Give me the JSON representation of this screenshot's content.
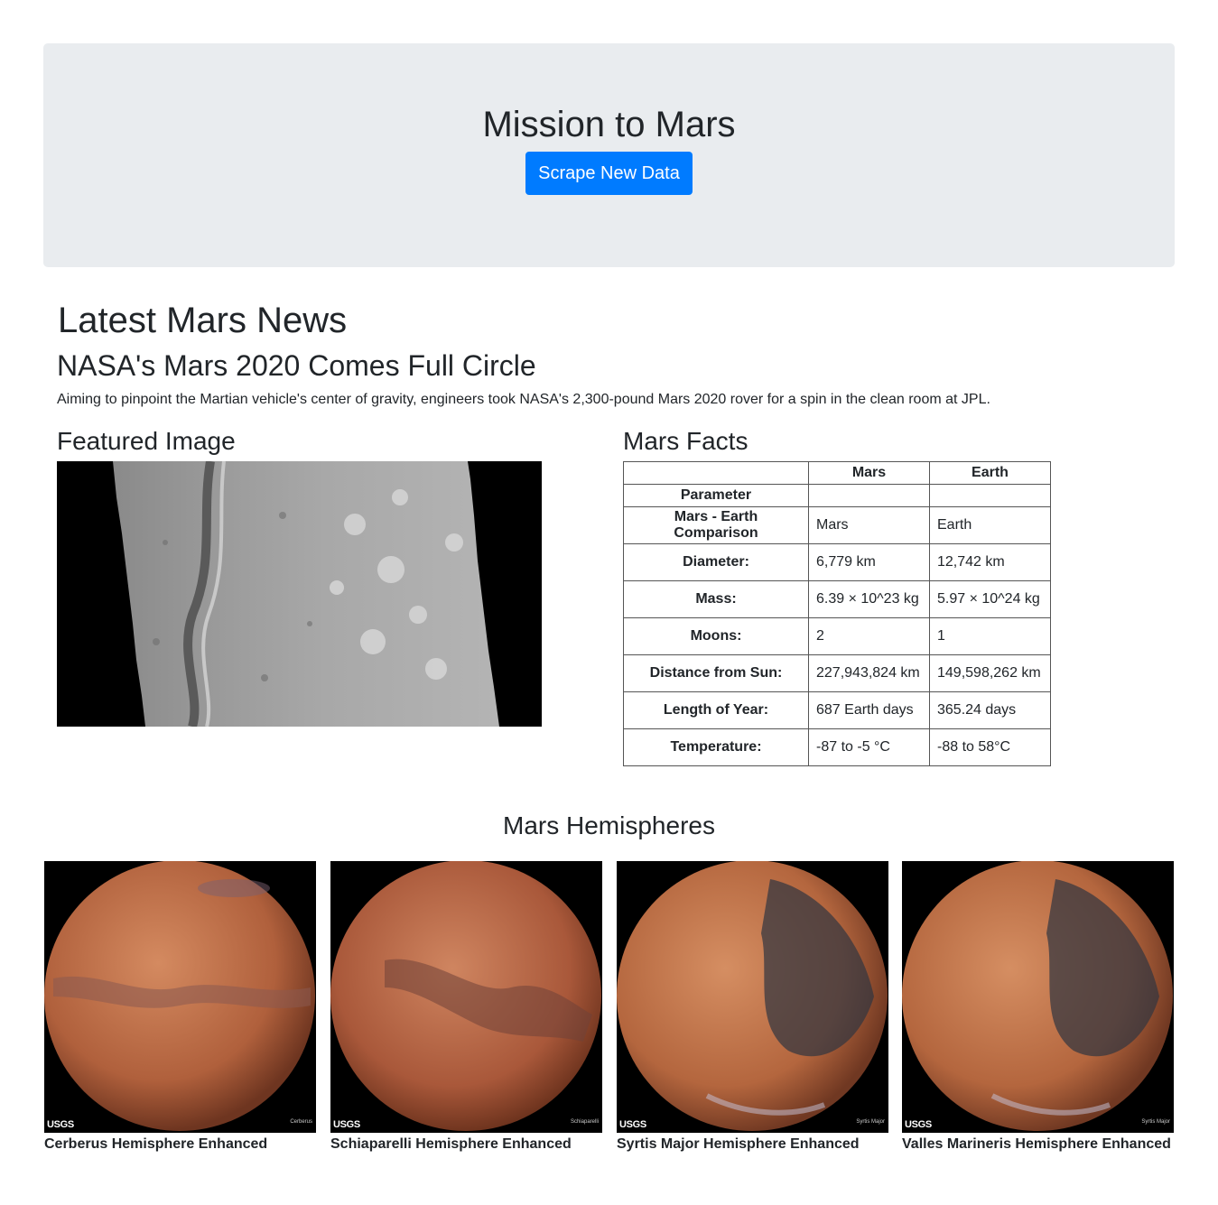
{
  "header": {
    "title": "Mission to Mars",
    "scrape_button": "Scrape New Data",
    "bg_color": "#e9ecef",
    "button_color": "#007bff"
  },
  "news": {
    "heading": "Latest Mars News",
    "title": "NASA's Mars 2020 Comes Full Circle",
    "paragraph": "Aiming to pinpoint the Martian vehicle's center of gravity, engineers took NASA's 2,300-pound Mars 2020 rover for a spin in the clean room at JPL."
  },
  "featured": {
    "heading": "Featured Image"
  },
  "facts": {
    "heading": "Mars Facts",
    "col_mars": "Mars",
    "col_earth": "Earth",
    "param_label": "Parameter",
    "rows": [
      {
        "label": "Mars - Earth Comparison",
        "mars": "Mars",
        "earth": "Earth"
      },
      {
        "label": "Diameter:",
        "mars": "6,779 km",
        "earth": "12,742 km"
      },
      {
        "label": "Mass:",
        "mars": "6.39 × 10^23 kg",
        "earth": "5.97 × 10^24 kg"
      },
      {
        "label": "Moons:",
        "mars": "2",
        "earth": "1"
      },
      {
        "label": "Distance from Sun:",
        "mars": "227,943,824 km",
        "earth": "149,598,262 km"
      },
      {
        "label": "Length of Year:",
        "mars": "687 Earth days",
        "earth": "365.24 days"
      },
      {
        "label": "Temperature:",
        "mars": "-87 to -5 °C",
        "earth": "-88 to 58°C"
      }
    ]
  },
  "hemispheres": {
    "heading": "Mars Hemispheres",
    "items": [
      {
        "caption": "Cerberus Hemisphere Enhanced",
        "logo": "USGS",
        "tag": "Cerberus"
      },
      {
        "caption": "Schiaparelli Hemisphere Enhanced",
        "logo": "USGS",
        "tag": "Schiaparelli"
      },
      {
        "caption": "Syrtis Major Hemisphere Enhanced",
        "logo": "USGS",
        "tag": "Syrtis Major"
      },
      {
        "caption": "Valles Marineris Hemisphere Enhanced",
        "logo": "USGS",
        "tag": "Syrtis Major"
      }
    ]
  }
}
